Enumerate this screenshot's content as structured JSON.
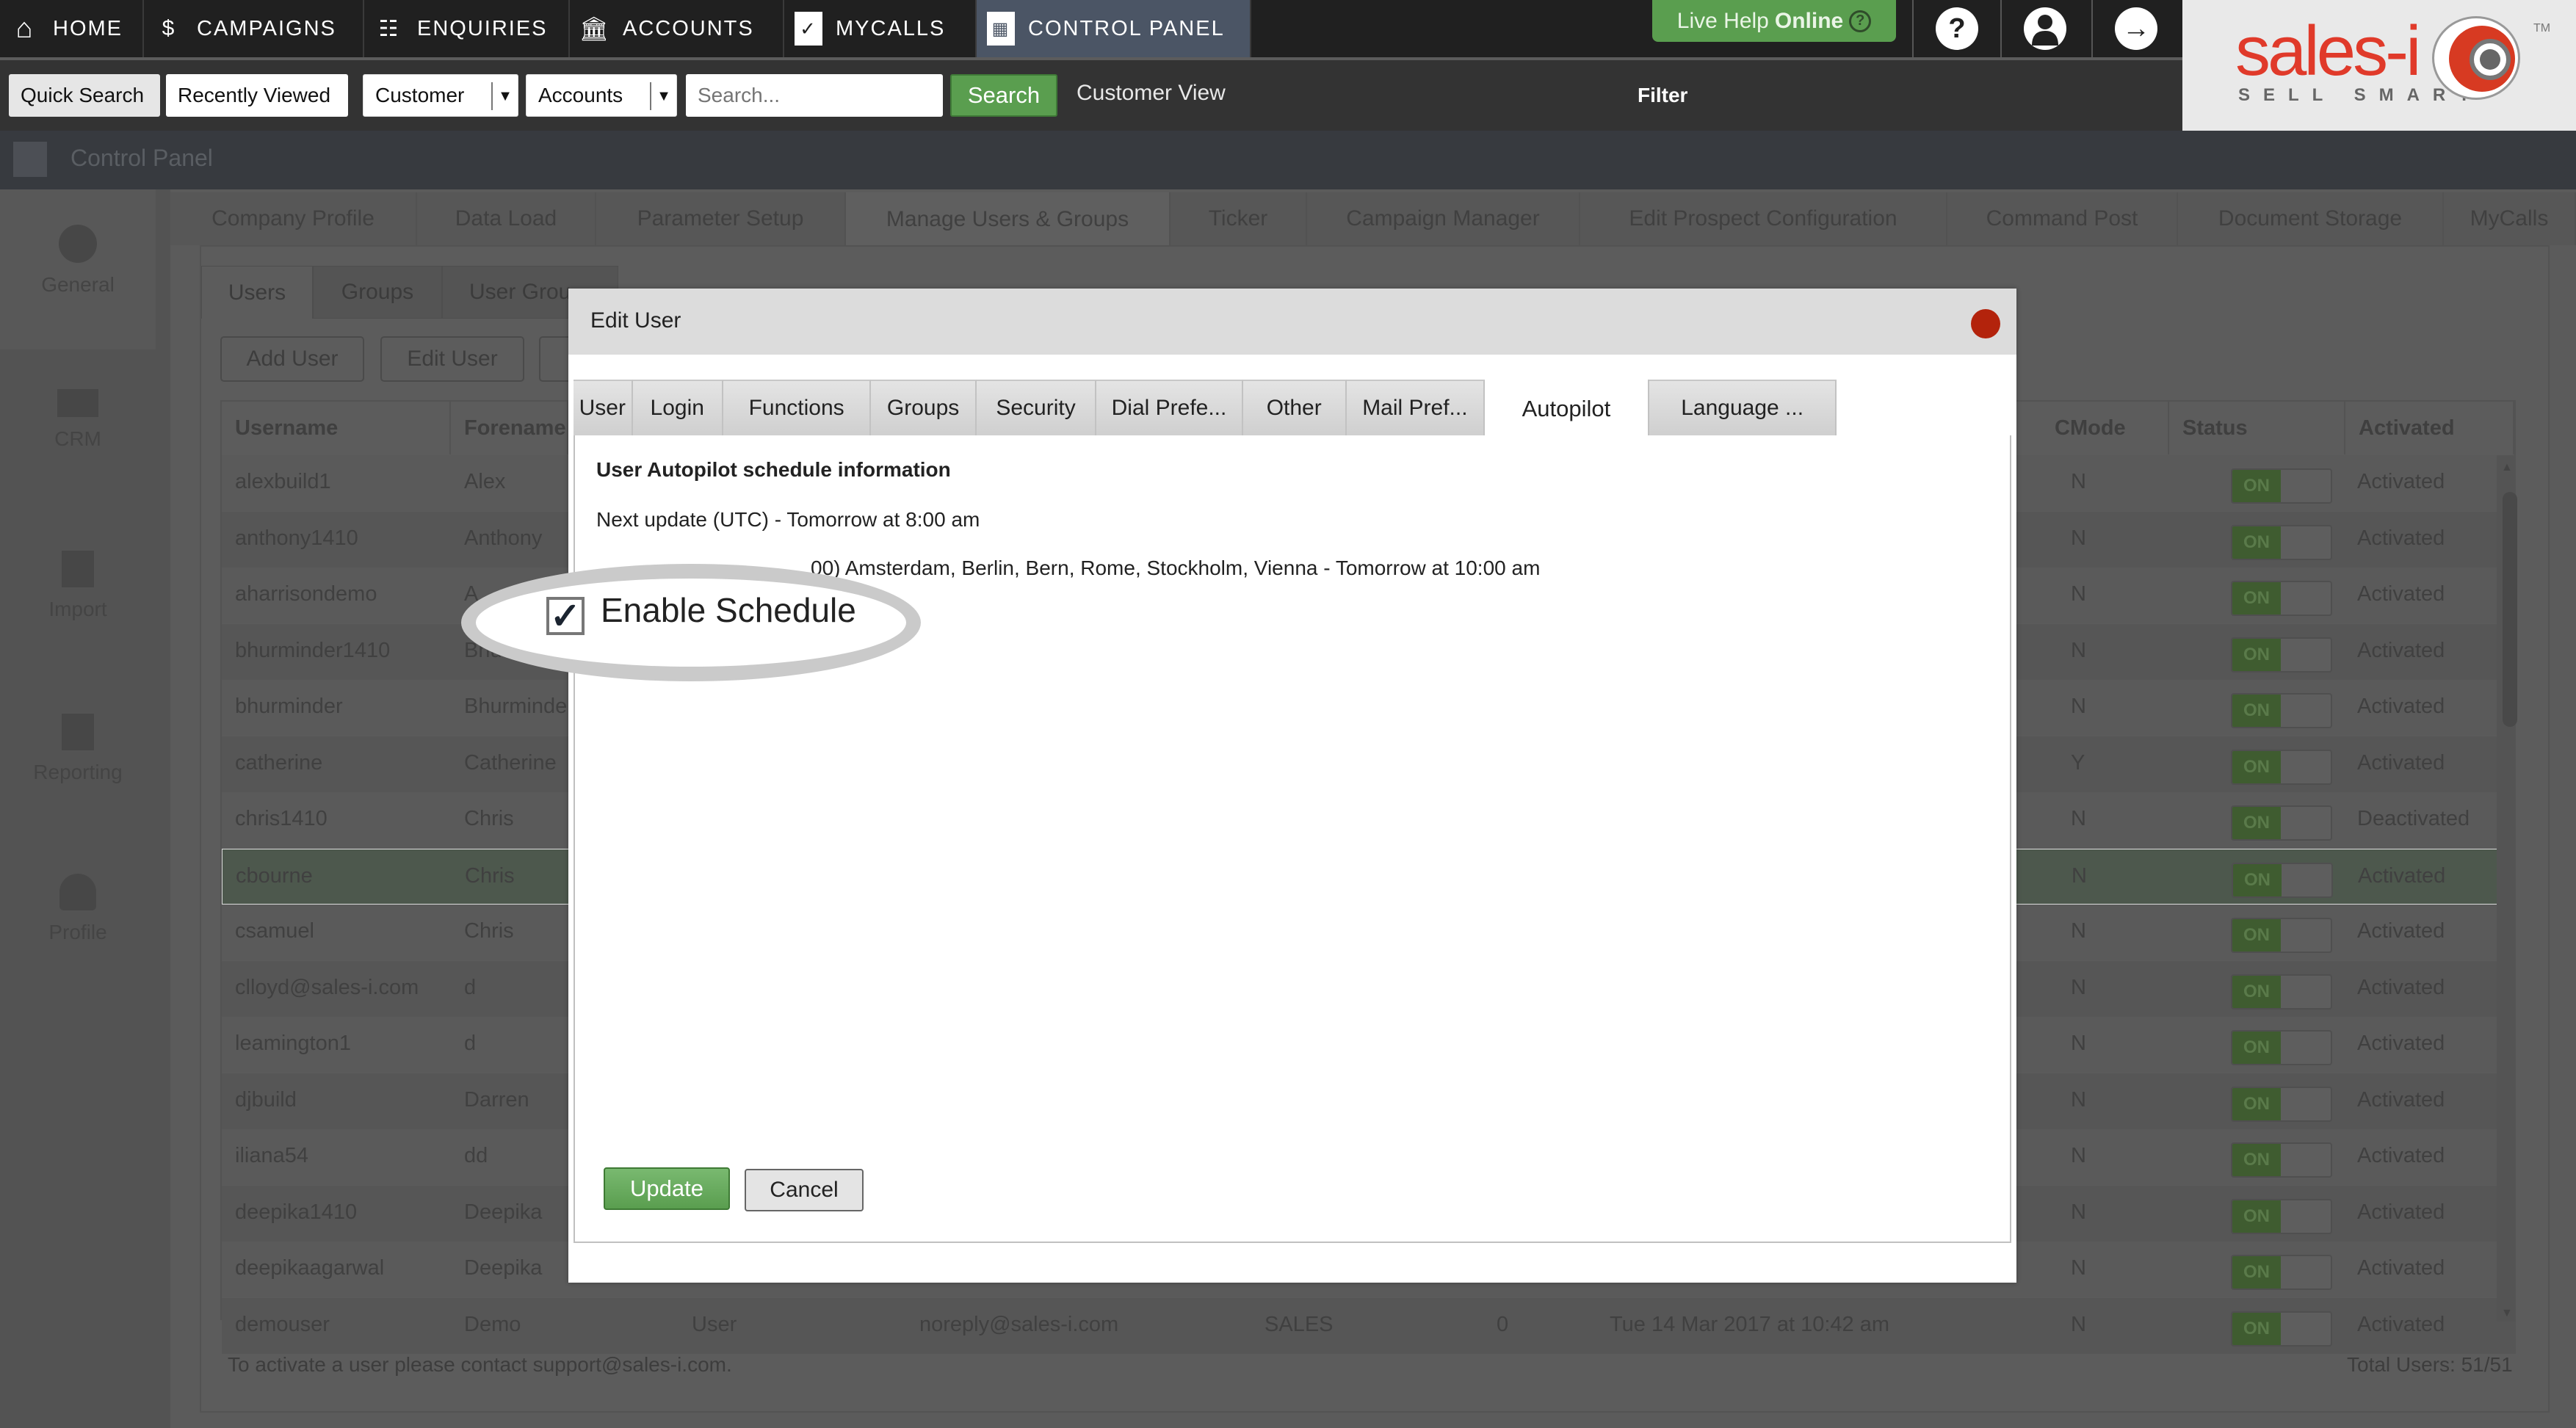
{
  "topnav": {
    "items": [
      {
        "label": "HOME",
        "icon": "home-icon"
      },
      {
        "label": "CAMPAIGNS",
        "icon": "campaigns-icon"
      },
      {
        "label": "ENQUIRIES",
        "icon": "enquiries-icon"
      },
      {
        "label": "ACCOUNTS",
        "icon": "accounts-icon"
      },
      {
        "label": "MYCALLS",
        "icon": "checklist-icon"
      },
      {
        "label": "CONTROL PANEL",
        "icon": "control-panel-icon",
        "active": true
      }
    ],
    "live_help": {
      "prefix": "Live Help",
      "status": "Online"
    },
    "help_glyph": "?",
    "logo": {
      "brand": "sales-i",
      "tagline": "SELL SMART",
      "tm": "TM"
    }
  },
  "toolbar": {
    "quick_search": "Quick Search",
    "recently_viewed": "Recently Viewed",
    "type_select": "Customer",
    "scope_select": "Accounts",
    "search_placeholder": "Search...",
    "search_button": "Search",
    "customer_view": "Customer View",
    "filter": "Filter"
  },
  "page": {
    "title": "Control Panel"
  },
  "sidebar": {
    "items": [
      {
        "label": "General",
        "icon": "gear-icon"
      },
      {
        "label": "CRM",
        "icon": "crm-icon"
      },
      {
        "label": "Import",
        "icon": "import-icon"
      },
      {
        "label": "Reporting",
        "icon": "reporting-icon"
      },
      {
        "label": "Profile",
        "icon": "profile-icon"
      }
    ]
  },
  "subtabs": [
    "Company Profile",
    "Data Load",
    "Parameter Setup",
    "Manage Users & Groups",
    "Ticker",
    "Campaign Manager",
    "Edit Prospect Configuration",
    "Command Post",
    "Document Storage",
    "MyCalls"
  ],
  "usertabs": [
    "Users",
    "Groups",
    "User Grou"
  ],
  "actions": {
    "add_user": "Add User",
    "edit_user": "Edit User"
  },
  "table": {
    "headers": {
      "username": "Username",
      "forename": "Forename",
      "cmode": "CMode",
      "status": "Status",
      "activated": "Activated"
    },
    "toggle_label": "ON",
    "rows": [
      {
        "username": "alexbuild1",
        "forename": "Alex",
        "cmode": "N",
        "activated": "Activated"
      },
      {
        "username": "anthony1410",
        "forename": "Anthony",
        "cmode": "N",
        "activated": "Activated"
      },
      {
        "username": "aharrisondemo",
        "forename": "A",
        "cmode": "N",
        "activated": "Activated"
      },
      {
        "username": "bhurminder1410",
        "forename": "Bhu",
        "cmode": "N",
        "activated": "Activated"
      },
      {
        "username": "bhurminder",
        "forename": "Bhurminde",
        "cmode": "N",
        "activated": "Activated"
      },
      {
        "username": "catherine",
        "forename": "Catherine",
        "cmode": "Y",
        "activated": "Activated"
      },
      {
        "username": "chris1410",
        "forename": "Chris",
        "cmode": "N",
        "activated": "Deactivated"
      },
      {
        "username": "cbourne",
        "forename": "Chris",
        "cmode": "N",
        "activated": "Activated",
        "selected": true
      },
      {
        "username": "csamuel",
        "forename": "Chris",
        "cmode": "N",
        "activated": "Activated"
      },
      {
        "username": "clloyd@sales-i.com",
        "forename": "d",
        "cmode": "N",
        "activated": "Activated"
      },
      {
        "username": "leamington1",
        "forename": "d",
        "cmode": "N",
        "activated": "Activated"
      },
      {
        "username": "djbuild",
        "forename": "Darren",
        "cmode": "N",
        "activated": "Activated"
      },
      {
        "username": "iliana54",
        "forename": "dd",
        "cmode": "N",
        "activated": "Activated"
      },
      {
        "username": "deepika1410",
        "forename": "Deepika",
        "cmode": "N",
        "activated": "Activated"
      },
      {
        "username": "deepikaagarwal",
        "forename": "Deepika",
        "cmode": "N",
        "activated": "Activated"
      },
      {
        "username": "demouser",
        "forename": "Demo",
        "surname": "User",
        "email": "noreply@sales-i.com",
        "group": "SALES",
        "count": "0",
        "last_login": "Tue 14 Mar 2017 at 10:42 am",
        "cmode": "N",
        "activated": "Activated"
      }
    ],
    "footnote": "To activate a user please contact support@sales-i.com.",
    "total": "Total Users: 51/51"
  },
  "modal": {
    "title": "Edit User",
    "tabs": [
      "User",
      "Login",
      "Functions",
      "Groups",
      "Security",
      "Dial Prefe...",
      "Other",
      "Mail Pref...",
      "Autopilot",
      "Language ..."
    ],
    "active_tab": "Autopilot",
    "heading": "User Autopilot schedule information",
    "next_update": "Next update (UTC) - Tomorrow at 8:00 am",
    "local_update": "00) Amsterdam, Berlin, Bern, Rome, Stockholm, Vienna - Tomorrow at 10:00 am",
    "enable_schedule": {
      "label": "Enable Schedule",
      "checked": true
    },
    "update_button": "Update",
    "cancel_button": "Cancel"
  },
  "colors": {
    "accent_green": "#5a9e4f",
    "close_red": "#b3230c",
    "nav_active": "#4b5565",
    "brand_red": "#e03a2a"
  }
}
